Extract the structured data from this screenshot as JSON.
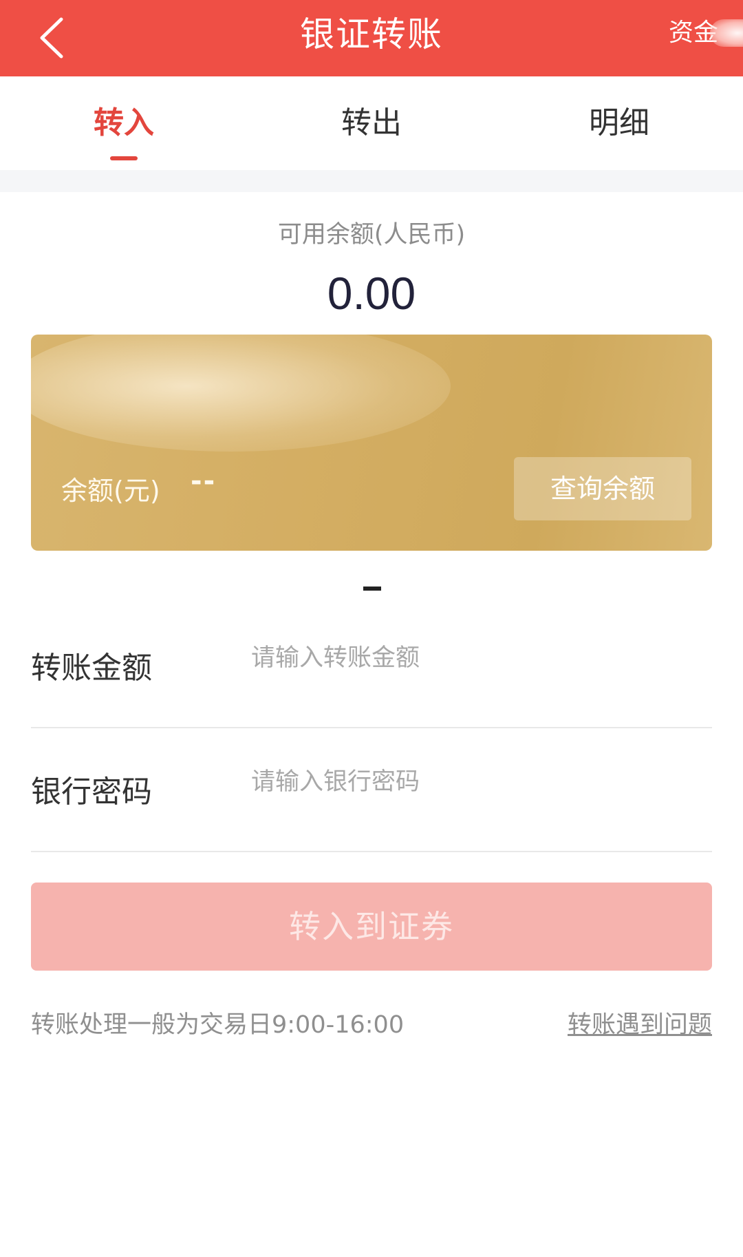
{
  "header": {
    "title": "银证转账",
    "right_label": "资金"
  },
  "tabs": [
    {
      "label": "转入",
      "active": true
    },
    {
      "label": "转出",
      "active": false
    },
    {
      "label": "明细",
      "active": false
    }
  ],
  "available": {
    "label": "可用余额(人民币)",
    "amount": "0.00"
  },
  "card": {
    "balance_label": "余额(元)",
    "balance_value": "--",
    "query_button": "查询余额"
  },
  "form": {
    "amount_label": "转账金额",
    "amount_placeholder": "请输入转账金额",
    "password_label": "银行密码",
    "password_placeholder": "请输入银行密码"
  },
  "submit_label": "转入到证券",
  "footer": {
    "note": "转账处理一般为交易日9:00-16:00",
    "help_link": "转账遇到问题"
  },
  "colors": {
    "header_bg": "#ef4f45",
    "accent": "#e3463d",
    "card_gold": "#d4ae63",
    "submit_disabled": "#f6b3ae"
  },
  "icons": {
    "back": "chevron-left-icon"
  }
}
